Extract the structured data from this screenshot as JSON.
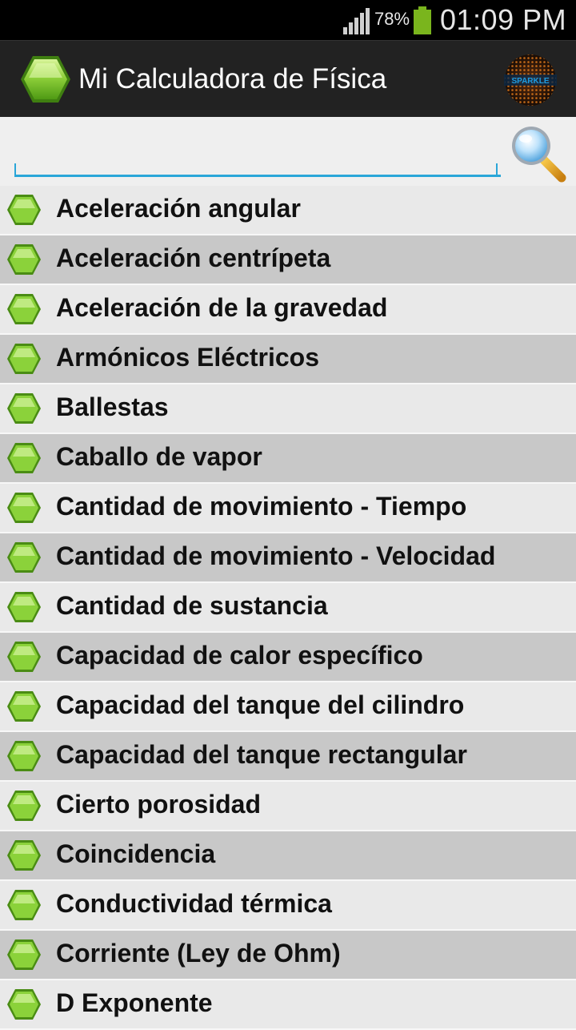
{
  "status_bar": {
    "battery_percent": "78%",
    "time": "01:09 PM",
    "icons": [
      "signal-icon",
      "battery-icon"
    ]
  },
  "action_bar": {
    "title": "Mi Calculadora de Física",
    "logo_text": "SPARKLE",
    "icons": [
      "app-hexagon-icon",
      "sparkle-logo-icon"
    ]
  },
  "search": {
    "value": "",
    "placeholder": "",
    "icon": "magnifier-icon"
  },
  "colors": {
    "accent": "#2aa6d8",
    "hex_green": "#8bd23a",
    "row_light": "#e9e9e9",
    "row_dark": "#c8c8c8"
  },
  "items": [
    {
      "label": "Aceleración angular"
    },
    {
      "label": "Aceleración centrípeta"
    },
    {
      "label": "Aceleración de la gravedad"
    },
    {
      "label": "Armónicos Eléctricos"
    },
    {
      "label": "Ballestas"
    },
    {
      "label": "Caballo de vapor"
    },
    {
      "label": "Cantidad de movimiento - Tiempo"
    },
    {
      "label": "Cantidad de movimiento - Velocidad"
    },
    {
      "label": "Cantidad de sustancia"
    },
    {
      "label": "Capacidad de calor específico"
    },
    {
      "label": "Capacidad del tanque del cilindro"
    },
    {
      "label": "Capacidad del tanque rectangular"
    },
    {
      "label": "Cierto porosidad"
    },
    {
      "label": "Coincidencia"
    },
    {
      "label": "Conductividad térmica"
    },
    {
      "label": "Corriente (Ley de Ohm)"
    },
    {
      "label": "D Exponente"
    }
  ]
}
